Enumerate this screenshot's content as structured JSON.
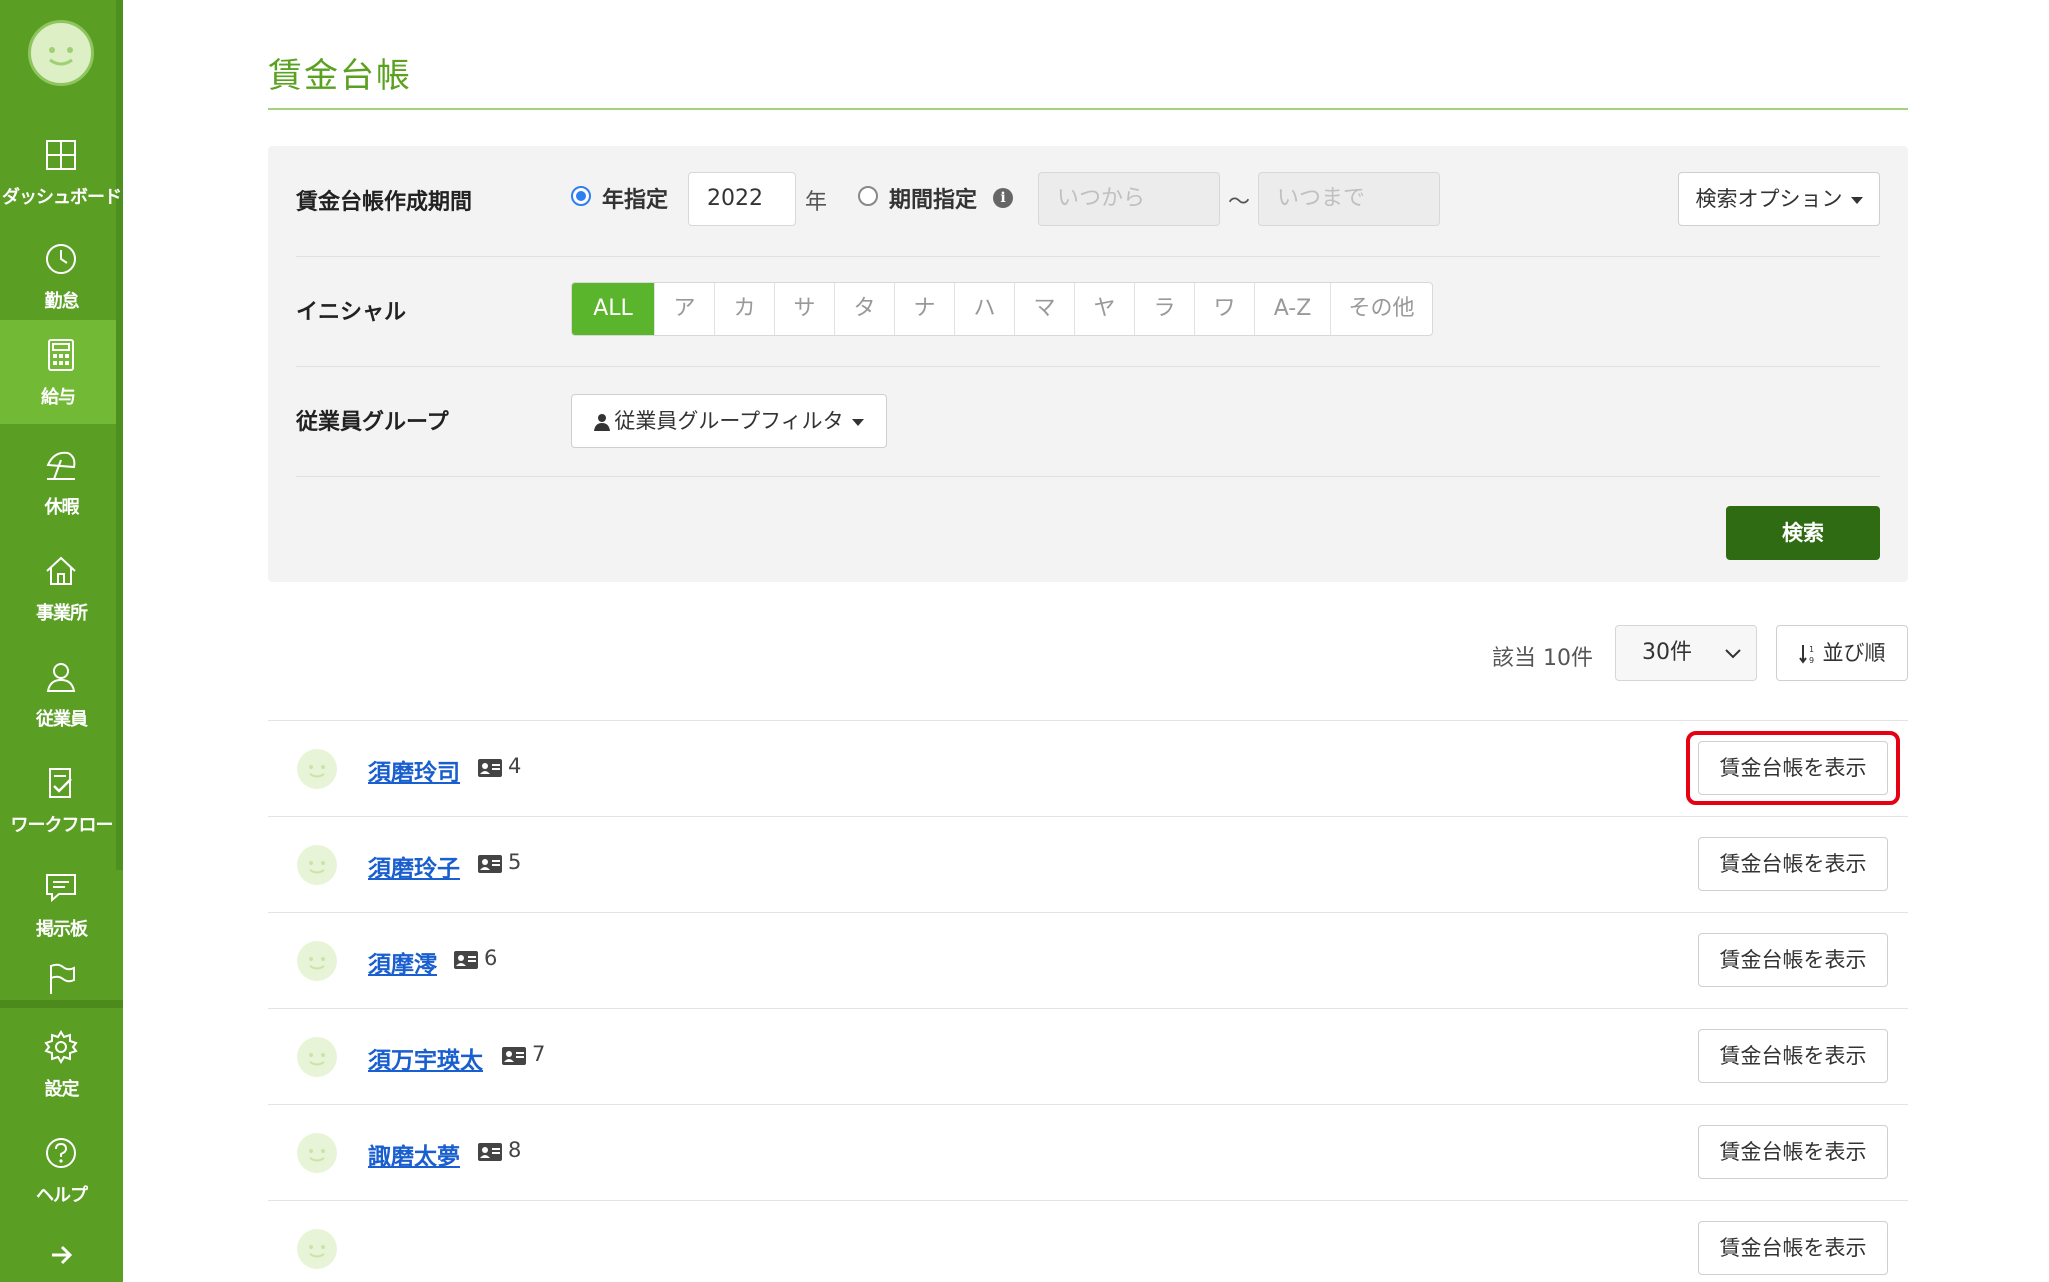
{
  "sidebar": {
    "items": [
      {
        "label": "ダッシュボード",
        "icon": "dashboard-icon"
      },
      {
        "label": "勤怠",
        "icon": "clock-icon"
      },
      {
        "label": "給与",
        "icon": "calculator-icon",
        "active": true
      },
      {
        "label": "休暇",
        "icon": "beach-umbrella-icon"
      },
      {
        "label": "事業所",
        "icon": "home-icon"
      },
      {
        "label": "従業員",
        "icon": "user-icon"
      },
      {
        "label": "ワークフロー",
        "icon": "checklist-icon"
      },
      {
        "label": "掲示板",
        "icon": "message-icon"
      },
      {
        "label": "",
        "icon": "flag-icon"
      },
      {
        "label": "設定",
        "icon": "gear-icon"
      },
      {
        "label": "ヘルプ",
        "icon": "help-icon"
      }
    ],
    "expand_icon": "arrow-right-icon"
  },
  "page": {
    "title": "賃金台帳"
  },
  "filters": {
    "period_label": "賃金台帳作成期間",
    "year_mode_label": "年指定",
    "year_value": "2022",
    "year_suffix": "年",
    "range_mode_label": "期間指定",
    "from_placeholder": "いつから",
    "tilde": "〜",
    "to_placeholder": "いつまで",
    "search_options_label": "検索オプション",
    "initial_label": "イニシャル",
    "initials": [
      "ALL",
      "ア",
      "カ",
      "サ",
      "タ",
      "ナ",
      "ハ",
      "マ",
      "ヤ",
      "ラ",
      "ワ",
      "A-Z",
      "その他"
    ],
    "group_label": "従業員グループ",
    "group_filter_label": "従業員グループフィルタ",
    "search_button": "検索"
  },
  "results": {
    "count_text": "該当 10件",
    "per_page": "30件",
    "sort_label": "並び順"
  },
  "employees": [
    {
      "name": "須磨玲司",
      "number": "4",
      "button": "賃金台帳を表示"
    },
    {
      "name": "須磨玲子",
      "number": "5",
      "button": "賃金台帳を表示"
    },
    {
      "name": "須摩澪",
      "number": "6",
      "button": "賃金台帳を表示"
    },
    {
      "name": "須万宇瑛太",
      "number": "7",
      "button": "賃金台帳を表示"
    },
    {
      "name": "諏磨太夢",
      "number": "8",
      "button": "賃金台帳を表示"
    },
    {
      "name": "",
      "number": "",
      "button": "賃金台帳を表示"
    }
  ],
  "colors": {
    "sidebar": "#5a9e24",
    "sidebar_active": "#72b935",
    "accent_green": "#5aa11f",
    "search_button": "#2f6b12",
    "link_blue": "#1a5fcf",
    "highlight_red": "#e60012"
  }
}
